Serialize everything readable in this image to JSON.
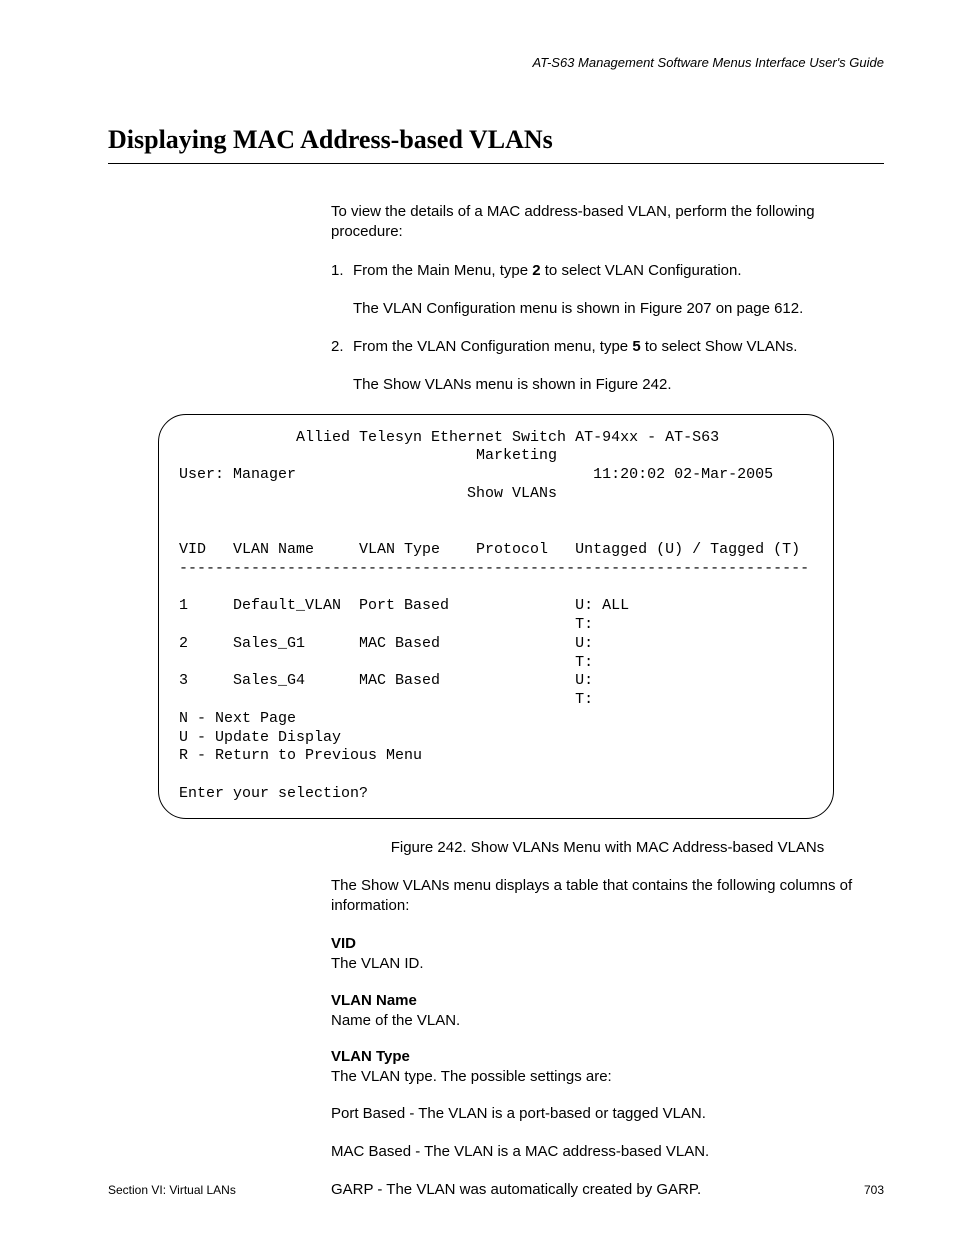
{
  "header": {
    "guide": "AT-S63 Management Software Menus Interface User's Guide"
  },
  "title": "Displaying MAC Address-based VLANs",
  "intro": "To view the details of a MAC address-based VLAN, perform the following procedure:",
  "steps": [
    {
      "num": "1.",
      "pre": "From the Main Menu, type ",
      "bold": "2",
      "post": " to select VLAN Configuration.",
      "follow": "The VLAN Configuration menu is shown in Figure 207 on page 612."
    },
    {
      "num": "2.",
      "pre": "From the VLAN Configuration menu, type ",
      "bold": "5",
      "post": " to select Show VLANs.",
      "follow": "The Show VLANs menu is shown in Figure 242."
    }
  ],
  "terminal": {
    "title_line": "             Allied Telesyn Ethernet Switch AT-94xx - AT-S63",
    "subtitle": "                                 Marketing",
    "user_line_left": "User: Manager",
    "user_line_right": "11:20:02 02-Mar-2005",
    "menu_name": "                                Show VLANs",
    "header_row": "VID   VLAN Name     VLAN Type    Protocol   Untagged (U) / Tagged (T)",
    "divider": "----------------------------------------------------------------------",
    "rows": [
      "1     Default_VLAN  Port Based              U: ALL",
      "                                            T:",
      "2     Sales_G1      MAC Based               U:",
      "                                            T:",
      "3     Sales_G4      MAC Based               U:",
      "                                            T:"
    ],
    "nav": [
      "N - Next Page",
      "U - Update Display",
      "R - Return to Previous Menu"
    ],
    "prompt": "Enter your selection?"
  },
  "figure_caption": "Figure 242. Show VLANs Menu with MAC Address-based VLANs",
  "explain": "The Show VLANs menu displays a table that contains the following columns of information:",
  "definitions": [
    {
      "term": "VID",
      "desc": "The VLAN ID."
    },
    {
      "term": "VLAN Name",
      "desc": "Name of the VLAN."
    },
    {
      "term": "VLAN Type",
      "desc": "The VLAN type. The possible settings are:"
    }
  ],
  "type_settings": [
    "Port Based - The VLAN is a port-based or tagged VLAN.",
    "MAC Based - The VLAN is a MAC address-based VLAN.",
    "GARP - The VLAN was automatically created by GARP."
  ],
  "footer": {
    "section": "Section VI: Virtual LANs",
    "page": "703"
  }
}
